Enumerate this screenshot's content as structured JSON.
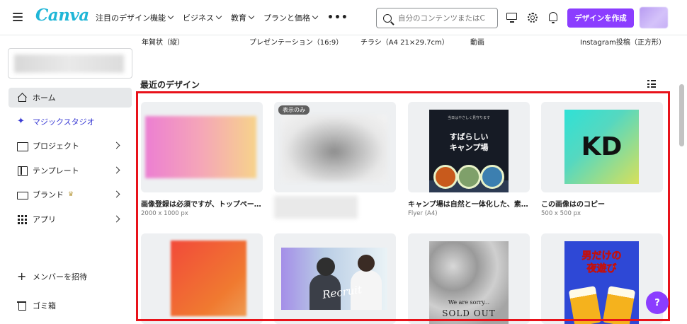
{
  "header": {
    "logo": "Canva",
    "nav": [
      "注目のデザイン機能",
      "ビジネス",
      "教育",
      "プランと価格"
    ],
    "more": "•••",
    "search_placeholder": "自分のコンテンツまたはC",
    "create_button": "デザインを作成",
    "help": "?"
  },
  "sidebar": {
    "items": [
      {
        "label": "ホーム",
        "icon": "home-icon",
        "active": true
      },
      {
        "label": "マジックスタジオ",
        "icon": "sparkle-icon"
      },
      {
        "label": "プロジェクト",
        "icon": "folder-icon"
      },
      {
        "label": "テンプレート",
        "icon": "template-icon"
      },
      {
        "label": "ブランド",
        "icon": "brand-icon"
      },
      {
        "label": "アプリ",
        "icon": "apps-icon"
      }
    ],
    "invite": "メンバーを招待",
    "trash": "ゴミ箱"
  },
  "main": {
    "top_labels": [
      "年賀状（縦）",
      "プレゼンテーション（16:9）",
      "チラシ（A4 21×29.7cm）",
      "動画",
      "Instagram投稿（正方形）"
    ],
    "section_title": "最近のデザイン",
    "cards": [
      {
        "title": "画像登録は必須ですが、トップペー…",
        "meta": "2000 x 1000 px"
      },
      {
        "badge": "表示のみ"
      },
      {
        "title": "キャンプ場は自然と一体化した、素…",
        "meta": "Flyer (A4)",
        "thumb": {
          "top": "当日はやさしく見守ります",
          "line1": "すばらしい",
          "line2": "キャンプ場"
        }
      },
      {
        "title": "この画像はのコピー",
        "meta": "500 x 500 px",
        "thumb": {
          "text": "KD"
        }
      },
      {},
      {
        "thumb": {
          "script": "Recruit"
        }
      },
      {
        "thumb": {
          "line1": "We are sorry...",
          "line2": "SOLD OUT"
        }
      },
      {
        "thumb": {
          "line1": "男だけの",
          "line2": "夜遊び"
        }
      }
    ]
  },
  "colors": {
    "accent": "#8b3dff",
    "highlight": "#e8121a",
    "logo": "#20b6d7"
  }
}
